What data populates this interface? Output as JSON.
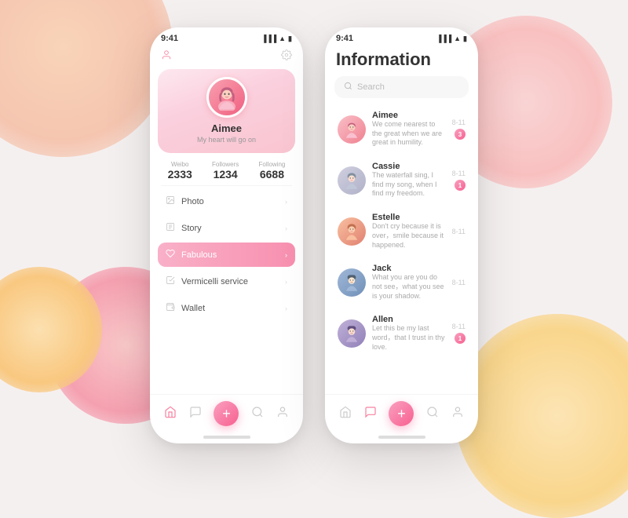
{
  "background": {
    "color": "#f0ecec"
  },
  "phone1": {
    "status_time": "9:41",
    "header_icons": [
      "person-icon",
      "gear-icon"
    ],
    "profile": {
      "name": "Aimee",
      "bio": "My heart will go on"
    },
    "stats": [
      {
        "label": "Weibo",
        "value": "2333"
      },
      {
        "label": "Followers",
        "value": "1234"
      },
      {
        "label": "Following",
        "value": "6688"
      }
    ],
    "menu_items": [
      {
        "id": "photo",
        "label": "Photo",
        "active": false
      },
      {
        "id": "story",
        "label": "Story",
        "active": false
      },
      {
        "id": "fabulous",
        "label": "Fabulous",
        "active": true
      },
      {
        "id": "vermicelli",
        "label": "Vermicelli service",
        "active": false
      },
      {
        "id": "wallet",
        "label": "Wallet",
        "active": false
      }
    ],
    "nav_items": [
      "home-icon",
      "chat-icon",
      "add-icon",
      "search-icon",
      "profile-icon"
    ]
  },
  "phone2": {
    "status_time": "9:41",
    "title": "Information",
    "search_placeholder": "Search",
    "messages": [
      {
        "id": "aimee",
        "name": "Aimee",
        "preview": "We come nearest to the great when we are great in humility.",
        "time": "8-11",
        "badge": "3",
        "avatar_color": "#f9a0b0"
      },
      {
        "id": "cassie",
        "name": "Cassie",
        "preview": "The waterfall sing, I find my song, when I find my freedom.",
        "time": "8-11",
        "badge": "1",
        "avatar_color": "#c0c0d0"
      },
      {
        "id": "estelle",
        "name": "Estelle",
        "preview": "Don't cry because it is over，smile because it happened.",
        "time": "8-11",
        "badge": "",
        "avatar_color": "#f9b0a0"
      },
      {
        "id": "jack",
        "name": "Jack",
        "preview": "What you are you do not see，what you see is your shadow.",
        "time": "8-11",
        "badge": "",
        "avatar_color": "#a0b8d0"
      },
      {
        "id": "allen",
        "name": "Allen",
        "preview": "Let this be my last word，that I trust in thy love.",
        "time": "8-11",
        "badge": "1",
        "avatar_color": "#b0a8d0"
      }
    ],
    "nav_items": [
      "home-icon",
      "chat-icon",
      "add-icon",
      "search-icon",
      "profile-icon"
    ]
  }
}
